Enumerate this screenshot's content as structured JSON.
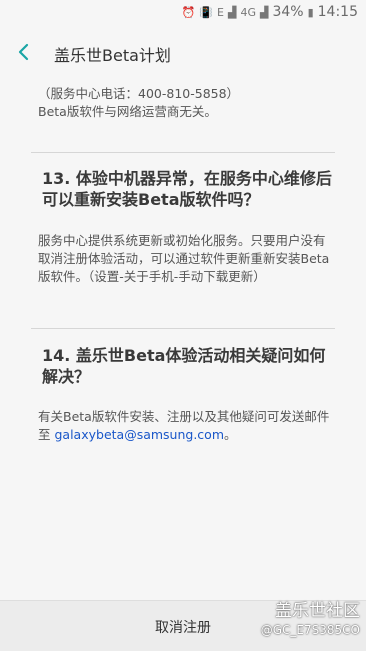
{
  "status_bar": {
    "icons": [
      "alarm-icon",
      "vibrate-icon",
      "sim-e-icon",
      "signal-icon",
      "lte-4g-icon",
      "signal-icon-2"
    ],
    "e_label": "E",
    "lte_label": "4G",
    "battery": "34%",
    "time": "14:15"
  },
  "header": {
    "title": "盖乐世Beta计划",
    "back_icon": "chevron-left-icon"
  },
  "content": {
    "cut_text_line1": "（服务中心电话：400-810-5858）",
    "cut_text_line2": "Beta版软件与网络运营商无关。",
    "q13": {
      "heading": "13. 体验中机器异常，在服务中心维修后可以重新安装Beta版软件吗？",
      "answer": "服务中心提供系统更新或初始化服务。只要用户没有取消注册体验活动，可以通过软件更新重新安装Beta版软件。（设置-关于手机-手动下载更新）"
    },
    "q14": {
      "heading": "14. 盖乐世Beta体验活动相关疑问如何解决？",
      "answer_prefix": "有关Beta版软件安装、注册以及其他疑问可发送邮件至 ",
      "email": "galaxybeta@samsung.com",
      "answer_suffix": "。"
    }
  },
  "bottom_bar": {
    "cancel_label": "取消注册"
  },
  "watermark": {
    "line1": "盖乐世社区",
    "line2": "@GC_E7S385CO"
  },
  "colors": {
    "accent": "#1aa6a6",
    "link": "#1a57c9",
    "background": "#f6f6f6"
  }
}
